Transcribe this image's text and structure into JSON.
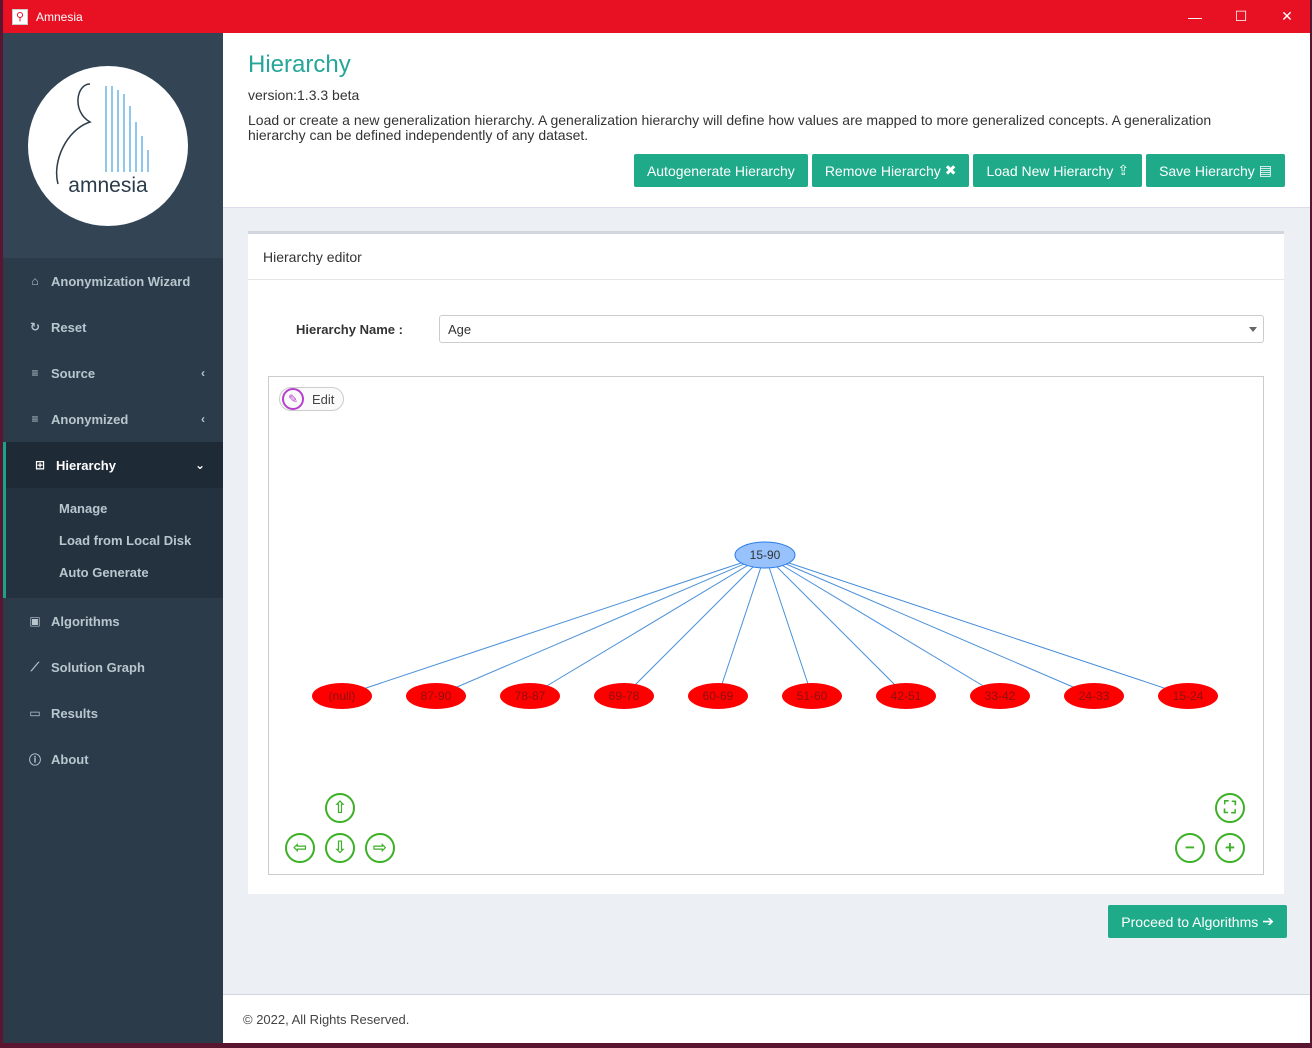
{
  "window": {
    "title": "Amnesia",
    "minimize": "—",
    "maximize": "☐",
    "close": "✕"
  },
  "sidebar": {
    "logo_text": "amnesia",
    "items": [
      {
        "label": "Anonymization Wizard",
        "icon": "home-icon"
      },
      {
        "label": "Reset",
        "icon": "refresh-icon"
      },
      {
        "label": "Source",
        "icon": "database-icon",
        "has_chevron": true
      },
      {
        "label": "Anonymized",
        "icon": "database-icon",
        "has_chevron": true
      },
      {
        "label": "Hierarchy",
        "icon": "sitemap-icon",
        "active": true
      },
      {
        "label": "Algorithms",
        "icon": "lock-icon"
      },
      {
        "label": "Solution Graph",
        "icon": "line-chart-icon"
      },
      {
        "label": "Results",
        "icon": "laptop-icon"
      },
      {
        "label": "About",
        "icon": "info-icon"
      }
    ],
    "subitems": [
      "Manage",
      "Load from Local Disk",
      "Auto Generate"
    ]
  },
  "header": {
    "title": "Hierarchy",
    "version": "version:1.3.3 beta",
    "description": "Load or create a new generalization hierarchy. A generalization hierarchy will define how values are mapped to more generalized concepts. A generalization hierarchy can be defined independently of any dataset.",
    "buttons": {
      "autogenerate": "Autogenerate Hierarchy",
      "remove": "Remove Hierarchy",
      "load": "Load New Hierarchy",
      "save": "Save Hierarchy"
    }
  },
  "editor": {
    "box_title": "Hierarchy editor",
    "name_label": "Hierarchy Name :",
    "name_value": "Age",
    "edit_label": "Edit"
  },
  "tree": {
    "root": "15-90",
    "children": [
      "(null)",
      "87-90",
      "78-87",
      "69-78",
      "60-69",
      "51-60",
      "42-51",
      "33-42",
      "24-33",
      "15-24"
    ],
    "root_color": "#97c2fc",
    "child_color": "#ff0000",
    "edge_color": "#4a90d9"
  },
  "proceed_label": "Proceed to Algorithms",
  "footer": "© 2022, All Rights Reserved.",
  "colors": {
    "accent": "#1fab89",
    "titlebar": "#e81123",
    "sidebar": "#2c3b4a"
  }
}
